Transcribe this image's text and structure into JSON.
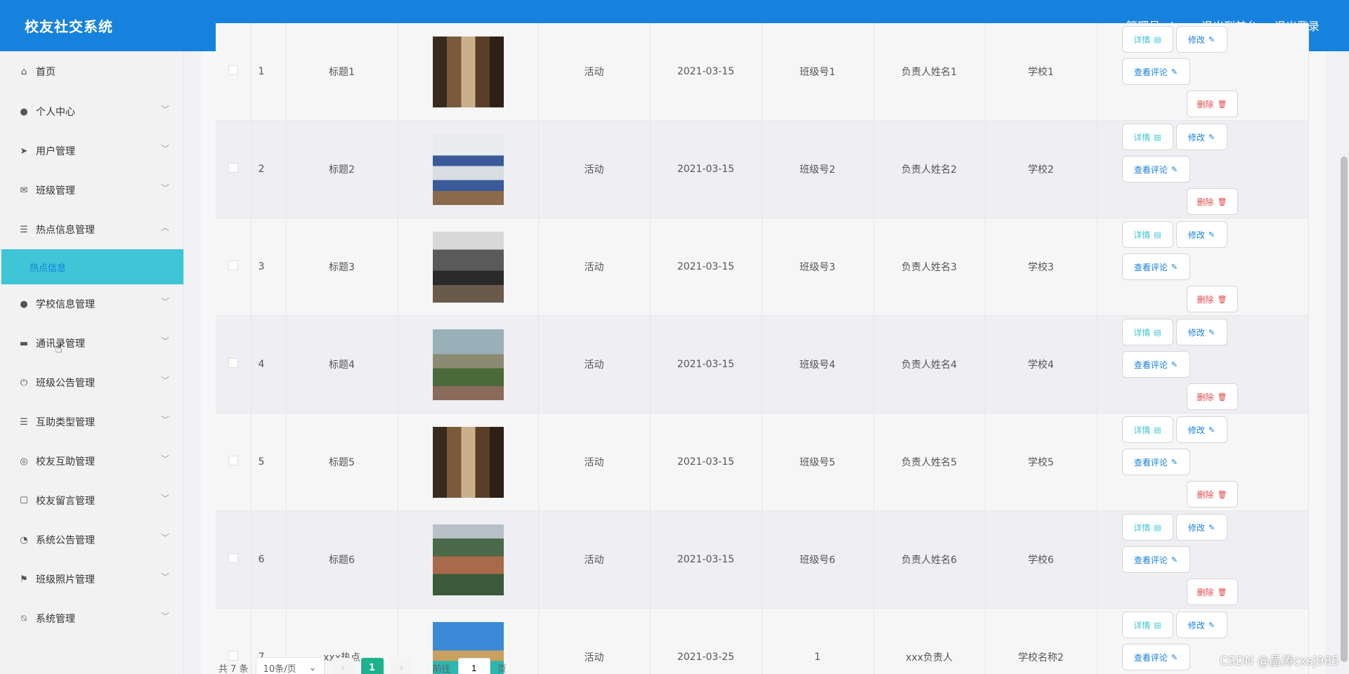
{
  "header": {
    "title": "校友社交系统",
    "admin_label": "管理员 abo",
    "front_label": "退出到前台",
    "logout_label": "退出登录"
  },
  "sidebar": {
    "items": [
      {
        "label": "首页",
        "icon": "home-icon",
        "chevron": false
      },
      {
        "label": "个人中心",
        "icon": "user-icon",
        "chevron": true
      },
      {
        "label": "用户管理",
        "icon": "send-icon",
        "chevron": true
      },
      {
        "label": "班级管理",
        "icon": "mail-icon",
        "chevron": true
      },
      {
        "label": "热点信息管理",
        "icon": "menu-icon",
        "chevron": true,
        "expanded": true
      },
      {
        "label": "学校信息管理",
        "icon": "person-icon",
        "chevron": true
      },
      {
        "label": "通讯录管理",
        "icon": "book-icon",
        "chevron": true
      },
      {
        "label": "班级公告管理",
        "icon": "power-icon",
        "chevron": true
      },
      {
        "label": "互助类型管理",
        "icon": "list-icon",
        "chevron": true
      },
      {
        "label": "校友互助管理",
        "icon": "target-icon",
        "chevron": true
      },
      {
        "label": "校友留言管理",
        "icon": "message-icon",
        "chevron": true
      },
      {
        "label": "系统公告管理",
        "icon": "compass-icon",
        "chevron": true
      },
      {
        "label": "班级照片管理",
        "icon": "flag-icon",
        "chevron": true
      },
      {
        "label": "系统管理",
        "icon": "bell-off-icon",
        "chevron": true
      }
    ],
    "active_sub": "热点信息"
  },
  "table": {
    "rows": [
      {
        "no": "1",
        "title": "标题1",
        "type": "活动",
        "date": "2021-03-15",
        "class_no": "班级号1",
        "leader": "负责人姓名1",
        "school": "学校1",
        "img": "dorm-brown"
      },
      {
        "no": "2",
        "title": "标题2",
        "type": "活动",
        "date": "2021-03-15",
        "class_no": "班级号2",
        "leader": "负责人姓名2",
        "school": "学校2",
        "img": "dorm-blue"
      },
      {
        "no": "3",
        "title": "标题3",
        "type": "活动",
        "date": "2021-03-15",
        "class_no": "班级号3",
        "leader": "负责人姓名3",
        "school": "学校3",
        "img": "meeting-room"
      },
      {
        "no": "4",
        "title": "标题4",
        "type": "活动",
        "date": "2021-03-15",
        "class_no": "班级号4",
        "leader": "负责人姓名4",
        "school": "学校4",
        "img": "garden-pavilion"
      },
      {
        "no": "5",
        "title": "标题5",
        "type": "活动",
        "date": "2021-03-15",
        "class_no": "班级号5",
        "leader": "负责人姓名5",
        "school": "学校5",
        "img": "dorm-brown"
      },
      {
        "no": "6",
        "title": "标题6",
        "type": "活动",
        "date": "2021-03-15",
        "class_no": "班级号6",
        "leader": "负责人姓名6",
        "school": "学校6",
        "img": "campus-aerial"
      },
      {
        "no": "7",
        "title": "xxx热点",
        "type": "活动",
        "date": "2021-03-25",
        "class_no": "1",
        "leader": "xxx负责人",
        "school": "学校名称2",
        "img": "beach-hut"
      }
    ],
    "actions": {
      "detail": "详情",
      "edit": "修改",
      "comment": "查看评论",
      "delete": "删除"
    }
  },
  "pager": {
    "total": "共 7 条",
    "page_size": "10条/页",
    "current_page": "1",
    "goto_label": "前往",
    "goto_value": "1",
    "page_unit": "页"
  },
  "watermark": "CSDN @晶涛cxsj985",
  "colors": {
    "primary": "#1682de",
    "active_sub_bg": "#3ec5d6",
    "pager_active": "#1fb28e",
    "danger": "#e04a4a"
  }
}
